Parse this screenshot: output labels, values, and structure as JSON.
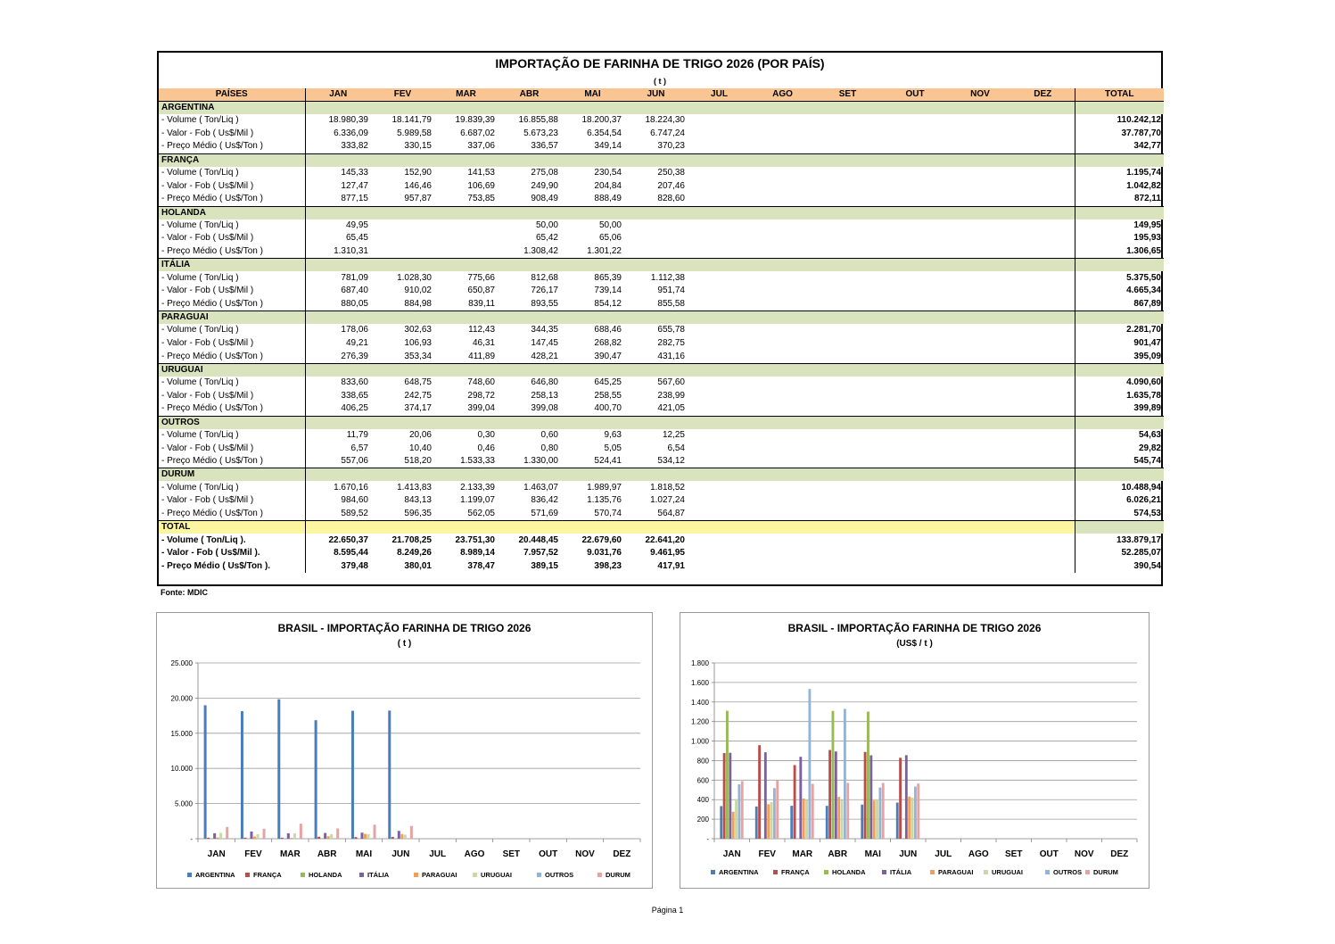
{
  "table": {
    "title": "IMPORTAÇÃO DE FARINHA DE TRIGO 2026 (POR PAÍS)",
    "unit": "( t )",
    "headers": [
      "PAÍSES",
      "JAN",
      "FEV",
      "MAR",
      "ABR",
      "MAI",
      "JUN",
      "JUL",
      "AGO",
      "SET",
      "OUT",
      "NOV",
      "DEZ",
      "TOTAL"
    ],
    "groups": [
      {
        "name": "ARGENTINA",
        "rows": [
          {
            "label": " - Volume ( Ton/Liq )",
            "values": [
              "18.980,39",
              "18.141,79",
              "19.839,39",
              "16.855,88",
              "18.200,37",
              "18.224,30"
            ],
            "total": "110.242,12"
          },
          {
            "label": " - Valor - Fob  ( Us$/Mil )",
            "values": [
              "6.336,09",
              "5.989,58",
              "6.687,02",
              "5.673,23",
              "6.354,54",
              "6.747,24"
            ],
            "total": "37.787,70"
          },
          {
            "label": " - Preço Médio ( Us$/Ton )",
            "values": [
              "333,82",
              "330,15",
              "337,06",
              "336,57",
              "349,14",
              "370,23"
            ],
            "total": "342,77"
          }
        ]
      },
      {
        "name": "FRANÇA",
        "rows": [
          {
            "label": " - Volume ( Ton/Liq )",
            "values": [
              "145,33",
              "152,90",
              "141,53",
              "275,08",
              "230,54",
              "250,38"
            ],
            "total": "1.195,74"
          },
          {
            "label": " - Valor - Fob  ( Us$/Mil )",
            "values": [
              "127,47",
              "146,46",
              "106,69",
              "249,90",
              "204,84",
              "207,46"
            ],
            "total": "1.042,82"
          },
          {
            "label": " - Preço Médio ( Us$/Ton )",
            "values": [
              "877,15",
              "957,87",
              "753,85",
              "908,49",
              "888,49",
              "828,60"
            ],
            "total": "872,11"
          }
        ]
      },
      {
        "name": "HOLANDA",
        "rows": [
          {
            "label": " - Volume ( Ton/Liq )",
            "values": [
              "49,95",
              "",
              "",
              "50,00",
              "50,00",
              ""
            ],
            "total": "149,95"
          },
          {
            "label": " - Valor - Fob  ( Us$/Mil )",
            "values": [
              "65,45",
              "",
              "",
              "65,42",
              "65,06",
              ""
            ],
            "total": "195,93"
          },
          {
            "label": " - Preço Médio ( Us$/Ton )",
            "values": [
              "1.310,31",
              "",
              "",
              "1.308,42",
              "1.301,22",
              ""
            ],
            "total": "1.306,65"
          }
        ]
      },
      {
        "name": "ITÁLIA",
        "rows": [
          {
            "label": " - Volume ( Ton/Liq )",
            "values": [
              "781,09",
              "1.028,30",
              "775,66",
              "812,68",
              "865,39",
              "1.112,38"
            ],
            "total": "5.375,50"
          },
          {
            "label": " - Valor - Fob  ( Us$/Mil )",
            "values": [
              "687,40",
              "910,02",
              "650,87",
              "726,17",
              "739,14",
              "951,74"
            ],
            "total": "4.665,34"
          },
          {
            "label": " - Preço Médio ( Us$/Ton )",
            "values": [
              "880,05",
              "884,98",
              "839,11",
              "893,55",
              "854,12",
              "855,58"
            ],
            "total": "867,89"
          }
        ]
      },
      {
        "name": "PARAGUAI",
        "rows": [
          {
            "label": " - Volume ( Ton/Liq )",
            "values": [
              "178,06",
              "302,63",
              "112,43",
              "344,35",
              "688,46",
              "655,78"
            ],
            "total": "2.281,70"
          },
          {
            "label": " - Valor - Fob  ( Us$/Mil )",
            "values": [
              "49,21",
              "106,93",
              "46,31",
              "147,45",
              "268,82",
              "282,75"
            ],
            "total": "901,47"
          },
          {
            "label": " - Preço Médio ( Us$/Ton )",
            "values": [
              "276,39",
              "353,34",
              "411,89",
              "428,21",
              "390,47",
              "431,16"
            ],
            "total": "395,09"
          }
        ]
      },
      {
        "name": "URUGUAI",
        "rows": [
          {
            "label": " - Volume ( Ton/Liq )",
            "values": [
              "833,60",
              "648,75",
              "748,60",
              "646,80",
              "645,25",
              "567,60"
            ],
            "total": "4.090,60"
          },
          {
            "label": " - Valor - Fob  ( Us$/Mil )",
            "values": [
              "338,65",
              "242,75",
              "298,72",
              "258,13",
              "258,55",
              "238,99"
            ],
            "total": "1.635,78"
          },
          {
            "label": " - Preço Médio ( Us$/Ton )",
            "values": [
              "406,25",
              "374,17",
              "399,04",
              "399,08",
              "400,70",
              "421,05"
            ],
            "total": "399,89"
          }
        ]
      },
      {
        "name": "OUTROS",
        "rows": [
          {
            "label": " - Volume ( Ton/Liq )",
            "values": [
              "11,79",
              "20,06",
              "0,30",
              "0,60",
              "9,63",
              "12,25"
            ],
            "total": "54,63"
          },
          {
            "label": " - Valor - Fob  ( Us$/Mil )",
            "values": [
              "6,57",
              "10,40",
              "0,46",
              "0,80",
              "5,05",
              "6,54"
            ],
            "total": "29,82"
          },
          {
            "label": " - Preço Médio ( Us$/Ton )",
            "values": [
              "557,06",
              "518,20",
              "1.533,33",
              "1.330,00",
              "524,41",
              "534,12"
            ],
            "total": "545,74"
          }
        ]
      },
      {
        "name": "DURUM",
        "rows": [
          {
            "label": " - Volume ( Ton/Liq )",
            "values": [
              "1.670,16",
              "1.413,83",
              "2.133,39",
              "1.463,07",
              "1.989,97",
              "1.818,52"
            ],
            "total": "10.488,94"
          },
          {
            "label": " - Valor - Fob  ( Us$/Mil )",
            "values": [
              "984,60",
              "843,13",
              "1.199,07",
              "836,42",
              "1.135,76",
              "1.027,24"
            ],
            "total": "6.026,21"
          },
          {
            "label": " - Preço Médio ( Us$/Ton )",
            "values": [
              "589,52",
              "596,35",
              "562,05",
              "571,69",
              "570,74",
              "564,87"
            ],
            "total": "574,53"
          }
        ]
      }
    ],
    "total": {
      "name": "TOTAL",
      "rows": [
        {
          "label": " - Volume ( Ton/Liq ).",
          "values": [
            "22.650,37",
            "21.708,25",
            "23.751,30",
            "20.448,45",
            "22.679,60",
            "22.641,20"
          ],
          "total": "133.879,17"
        },
        {
          "label": " - Valor - Fob  ( Us$/Mil ).",
          "values": [
            "8.595,44",
            "8.249,26",
            "8.989,14",
            "7.957,52",
            "9.031,76",
            "9.461,95"
          ],
          "total": "52.285,07"
        },
        {
          "label": " - Preço Médio ( Us$/Ton ).",
          "values": [
            "379,48",
            "380,01",
            "378,47",
            "389,15",
            "398,23",
            "417,91"
          ],
          "total": "390,54"
        }
      ]
    },
    "source": "Fonte: MDIC"
  },
  "page_label": "Página 1",
  "chart_data": [
    {
      "type": "bar",
      "title": "BRASIL -  IMPORTAÇÃO  FARINHA DE TRIGO 2026",
      "subtitle": "( t )",
      "categories": [
        "JAN",
        "FEV",
        "MAR",
        "ABR",
        "MAI",
        "JUN",
        "JUL",
        "AGO",
        "SET",
        "OUT",
        "NOV",
        "DEZ"
      ],
      "ylim": [
        0,
        25000
      ],
      "yticks": [
        "-",
        "5.000",
        "10.000",
        "15.000",
        "20.000",
        "25.000"
      ],
      "grid": true,
      "legend": "bottom",
      "series": [
        {
          "name": "ARGENTINA",
          "color": "#4a7ebb",
          "values": [
            18980.39,
            18141.79,
            19839.39,
            16855.88,
            18200.37,
            18224.3
          ]
        },
        {
          "name": "FRANÇA",
          "color": "#be4b48",
          "values": [
            145.33,
            152.9,
            141.53,
            275.08,
            230.54,
            250.38
          ]
        },
        {
          "name": "HOLANDA",
          "color": "#98b954",
          "values": [
            49.95,
            0,
            0,
            50.0,
            50.0,
            0
          ]
        },
        {
          "name": "ITÁLIA",
          "color": "#7d60a0",
          "values": [
            781.09,
            1028.3,
            775.66,
            812.68,
            865.39,
            1112.38
          ]
        },
        {
          "name": "PARAGUAI",
          "color": "#f59d56",
          "values": [
            178.06,
            302.63,
            112.43,
            344.35,
            688.46,
            655.78
          ]
        },
        {
          "name": "URUGUAI",
          "color": "#c9d8a4",
          "values": [
            833.6,
            648.75,
            748.6,
            646.8,
            645.25,
            567.6
          ]
        },
        {
          "name": "OUTROS",
          "color": "#95b3d7",
          "values": [
            11.79,
            20.06,
            0.3,
            0.6,
            9.63,
            12.25
          ]
        },
        {
          "name": "DURUM",
          "color": "#e6a3a2",
          "values": [
            1670.16,
            1413.83,
            2133.39,
            1463.07,
            1989.97,
            1818.52
          ]
        }
      ]
    },
    {
      "type": "bar",
      "title": "BRASIL -  IMPORTAÇÃO  FARINHA DE TRIGO 2026",
      "subtitle": "(US$ / t )",
      "categories": [
        "JAN",
        "FEV",
        "MAR",
        "ABR",
        "MAI",
        "JUN",
        "JUL",
        "AGO",
        "SET",
        "OUT",
        "NOV",
        "DEZ"
      ],
      "ylim": [
        0,
        1800
      ],
      "yticks": [
        "-",
        "200",
        "400",
        "600",
        "800",
        "1.000",
        "1.200",
        "1.400",
        "1.600",
        "1.800"
      ],
      "grid": true,
      "legend": "bottom",
      "series": [
        {
          "name": "ARGENTINA",
          "color": "#4a7ebb",
          "values": [
            333.82,
            330.15,
            337.06,
            336.57,
            349.14,
            370.23
          ]
        },
        {
          "name": "FRANÇA",
          "color": "#be4b48",
          "values": [
            877.15,
            957.87,
            753.85,
            908.49,
            888.49,
            828.6
          ]
        },
        {
          "name": "HOLANDA",
          "color": "#98b954",
          "values": [
            1310.31,
            0,
            0,
            1308.42,
            1301.22,
            0
          ]
        },
        {
          "name": "ITÁLIA",
          "color": "#7d60a0",
          "values": [
            880.05,
            884.98,
            839.11,
            893.55,
            854.12,
            855.58
          ]
        },
        {
          "name": "PARAGUAI",
          "color": "#f59d56",
          "values": [
            276.39,
            353.34,
            411.89,
            428.21,
            390.47,
            431.16
          ]
        },
        {
          "name": "URUGUAI",
          "color": "#c9d8a4",
          "values": [
            406.25,
            374.17,
            399.04,
            399.08,
            400.7,
            421.05
          ]
        },
        {
          "name": "OUTROS",
          "color": "#95b3d7",
          "values": [
            557.06,
            518.2,
            1533.33,
            1330.0,
            524.41,
            534.12
          ]
        },
        {
          "name": "DURUM",
          "color": "#e6a3a2",
          "values": [
            589.52,
            596.35,
            562.05,
            571.69,
            570.74,
            564.87
          ]
        }
      ]
    }
  ]
}
